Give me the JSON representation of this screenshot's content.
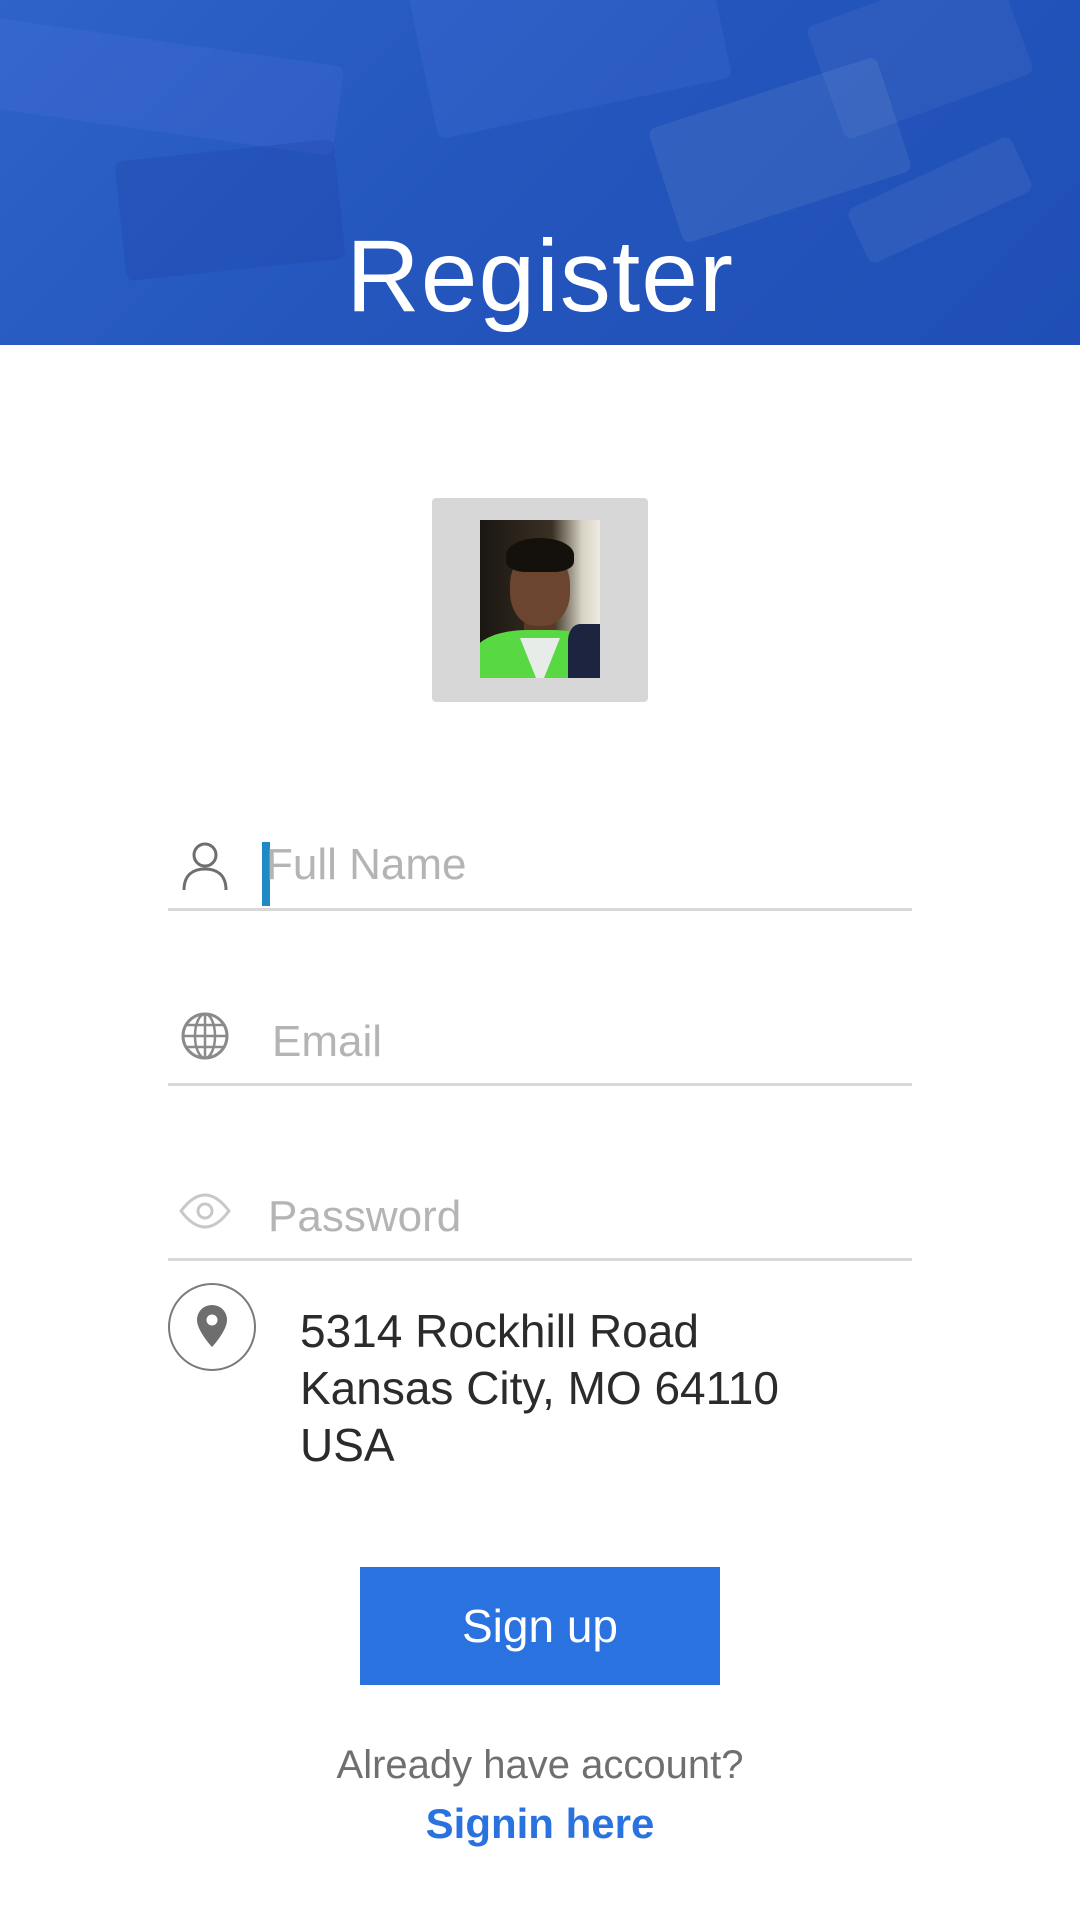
{
  "header": {
    "title": "Register"
  },
  "avatar": {
    "icon": "profile-photo"
  },
  "form": {
    "full_name": {
      "placeholder": "Full Name",
      "value": "",
      "icon": "person-icon"
    },
    "email": {
      "placeholder": "Email",
      "value": "",
      "icon": "globe-icon"
    },
    "password": {
      "placeholder": "Password",
      "value": "",
      "icon": "eye-icon"
    }
  },
  "address": {
    "icon": "location-pin-icon",
    "lines": [
      "5314 Rockhill Road",
      "Kansas City, MO 64110",
      "USA"
    ]
  },
  "actions": {
    "signup_label": "Sign up",
    "already_text": "Already have account?",
    "signin_label": "Signin here"
  },
  "colors": {
    "header_blue": "#2456bd",
    "button_blue": "#2a72e0",
    "caret_blue": "#1f8bc6",
    "divider_gray": "#d8d8d8"
  }
}
